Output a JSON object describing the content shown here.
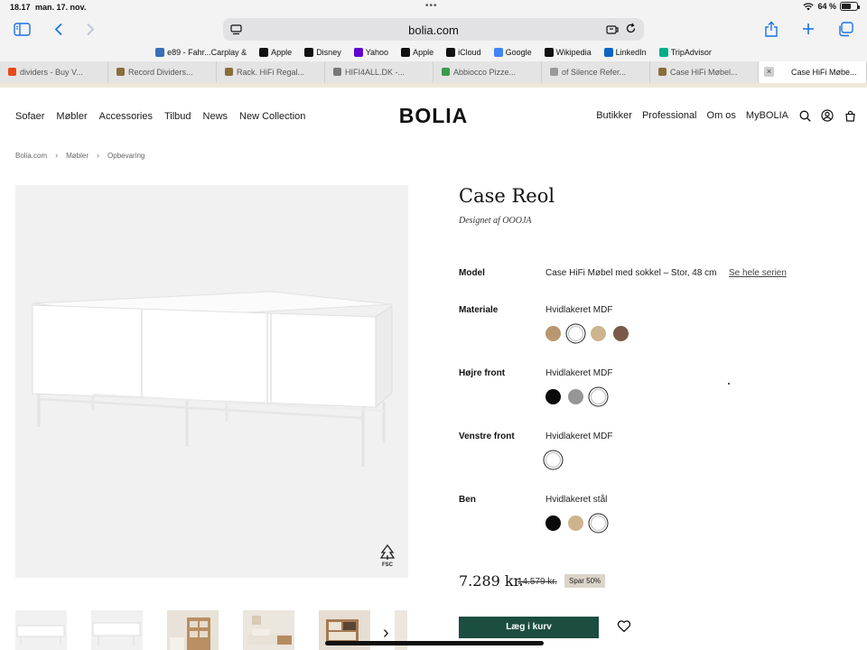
{
  "status_bar": {
    "time": "18.17",
    "date": "man. 17. nov.",
    "battery": "64 %",
    "battery_level": 0.64
  },
  "toolbar": {
    "url": "bolia.com"
  },
  "favorites": [
    {
      "label": "e89 - Fahr...Carplay &",
      "icon": "link-icon",
      "color": "#3b6fb6"
    },
    {
      "label": "Apple",
      "icon": "apple-icon",
      "color": "#111111"
    },
    {
      "label": "Disney",
      "icon": "disney-icon",
      "color": "#111111"
    },
    {
      "label": "Yahoo",
      "icon": "yahoo-icon",
      "color": "#6001d2"
    },
    {
      "label": "Apple",
      "icon": "apple-icon",
      "color": "#111111"
    },
    {
      "label": "iCloud",
      "icon": "apple-icon",
      "color": "#111111"
    },
    {
      "label": "Google",
      "icon": "google-icon",
      "color": "#4285f4"
    },
    {
      "label": "Wikipedia",
      "icon": "wikipedia-icon",
      "color": "#111111"
    },
    {
      "label": "LinkedIn",
      "icon": "linkedin-icon",
      "color": "#0a66c2"
    },
    {
      "label": "TripAdvisor",
      "icon": "tripadvisor-icon",
      "color": "#00af87"
    }
  ],
  "tabs": [
    {
      "label": "dividers - Buy V...",
      "color": "#e8481c"
    },
    {
      "label": "Record Dividers...",
      "color": "#8a6d3b"
    },
    {
      "label": "Rack. HiFi Regal...",
      "color": "#8a6d3b"
    },
    {
      "label": "HIFI4ALL.DK -...",
      "color": "#777777"
    },
    {
      "label": "Abbiocco Pizze...",
      "color": "#3e9a4a"
    },
    {
      "label": "of Silence Refer...",
      "color": "#999999"
    },
    {
      "label": "Case HiFi Møbel...",
      "color": "#8a6d3b"
    },
    {
      "label": "Case HiFi Møbe...",
      "color": "#8a6d3b"
    }
  ],
  "site": {
    "logo": "BOLIA",
    "nav_left": [
      "Sofaer",
      "Møbler",
      "Accessories",
      "Tilbud",
      "News",
      "New Collection"
    ],
    "nav_right": [
      "Butikker",
      "Professional",
      "Om os",
      "MyBOLIA"
    ]
  },
  "breadcrumb": [
    "Bolia.com",
    "Møbler",
    "Opbevaring"
  ],
  "product": {
    "title": "Case Reol",
    "designer": "Designet af OOOJA",
    "model_label": "Model",
    "model_value": "Case HiFi Møbel med sokkel – Stor, 48 cm",
    "series_link": "Se hele serien",
    "fsc_label": "FSC",
    "attributes": [
      {
        "label": "Materiale",
        "value": "Hvidlakeret MDF",
        "swatches": [
          {
            "name": "oak-swatch",
            "color": "#b99770",
            "selected": false
          },
          {
            "name": "white-swatch",
            "color": "#ffffff",
            "selected": true
          },
          {
            "name": "beige-swatch",
            "color": "#cdb48e",
            "selected": false
          },
          {
            "name": "walnut-swatch",
            "color": "#7a5a46",
            "selected": false
          }
        ]
      },
      {
        "label": "Højre front",
        "value": "Hvidlakeret MDF",
        "swatches": [
          {
            "name": "black-swatch",
            "color": "#0a0a0a",
            "selected": false
          },
          {
            "name": "grey-swatch",
            "color": "#969696",
            "selected": false
          },
          {
            "name": "white-swatch",
            "color": "#ffffff",
            "selected": true
          }
        ]
      },
      {
        "label": "Venstre front",
        "value": "Hvidlakeret MDF",
        "swatches": [
          {
            "name": "white-swatch",
            "color": "#ffffff",
            "selected": true
          }
        ]
      },
      {
        "label": "Ben",
        "value": "Hvidlakeret stål",
        "swatches": [
          {
            "name": "black-swatch",
            "color": "#0a0a0a",
            "selected": false
          },
          {
            "name": "beige-swatch",
            "color": "#cdb48e",
            "selected": false
          },
          {
            "name": "white-swatch",
            "color": "#ffffff",
            "selected": true
          }
        ]
      }
    ],
    "price": "7.289 kr.",
    "old_price": "14.579 kr.",
    "discount": "Spar 50%",
    "cart_button": "Læg i kurv"
  },
  "colors": {
    "accent": "#1c4d41",
    "image_bg": "#f1f1f1",
    "badge": "#dcd4c9"
  }
}
